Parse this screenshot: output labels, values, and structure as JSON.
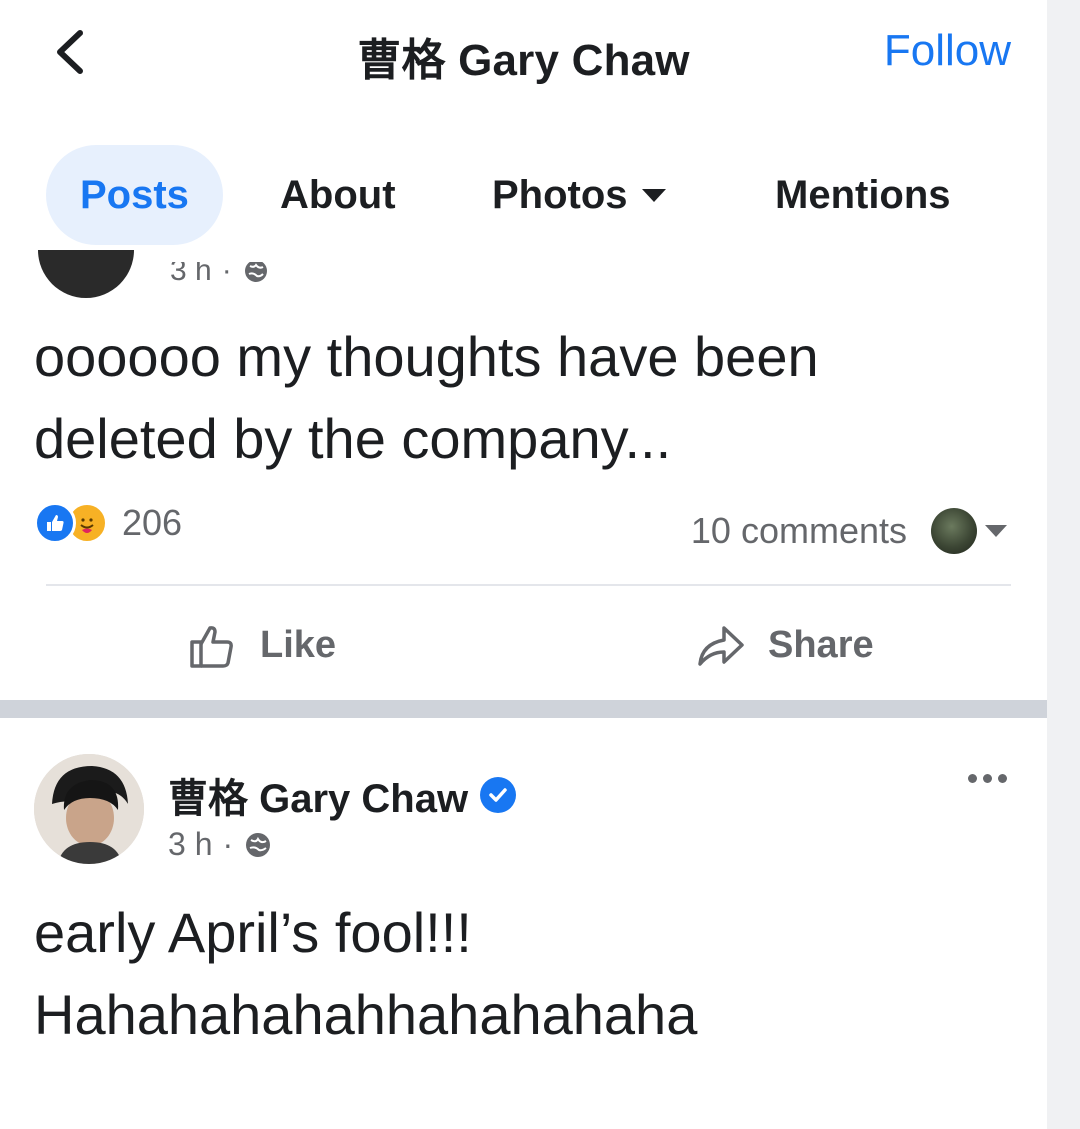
{
  "header": {
    "title": "曹格 Gary Chaw",
    "follow_label": "Follow"
  },
  "tabs": [
    {
      "label": "Posts",
      "active": true
    },
    {
      "label": "About",
      "active": false
    },
    {
      "label": "Photos",
      "active": false,
      "has_dropdown": true
    },
    {
      "label": "Mentions",
      "active": false
    }
  ],
  "post1": {
    "meta_time": "3 h",
    "text_line1": "oooooo my thoughts have been",
    "text_line2": "deleted by the company...",
    "reactions_count": "206",
    "comments_label": "10 comments",
    "like_label": "Like",
    "share_label": "Share"
  },
  "post2": {
    "author": "曹格 Gary Chaw",
    "meta_time": "3 h",
    "text_line1": "early April’s fool!!!",
    "text_line2": "Hahahahahahhahahahaha"
  },
  "colors": {
    "accent": "#1877f2",
    "active_tab_bg": "#e7f0fd",
    "secondary_text": "#65676b",
    "separator": "#cfd3da"
  },
  "icons": {
    "back": "chevron-left-icon",
    "globe": "globe-icon",
    "like": "thumbs-up-icon",
    "share": "share-arrow-icon",
    "verified": "verified-badge-icon",
    "more": "more-dots-icon"
  }
}
